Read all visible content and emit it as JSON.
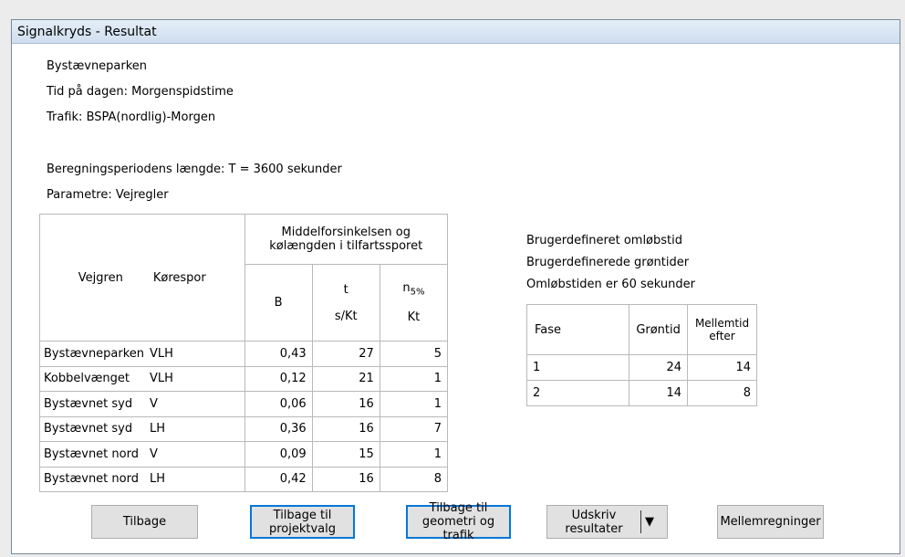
{
  "window": {
    "title": "Signalkryds - Resultat"
  },
  "info": {
    "location": "Bystævneparken",
    "time_of_day": "Tid på dagen: Morgenspidstime",
    "traffic": "Trafik: BSPA(nordlig)-Morgen",
    "period": "Beregningsperiodens længde: T = 3600 sekunder",
    "parameters": "Parametre: Vejregler"
  },
  "results": {
    "header": {
      "road": "Vejgren",
      "lane": "Kørespor",
      "group": "Middelforsinkelsen og kølængden i tilfartssporet",
      "col_b": "B",
      "col_t": "t",
      "col_t_unit": "s/Kt",
      "col_n": "n",
      "col_n_sub": "5%",
      "col_n_unit": "Kt"
    },
    "rows": [
      {
        "road": "Bystævneparken",
        "lane": "VLH",
        "b": "0,43",
        "t": "27",
        "n": "5"
      },
      {
        "road": "Kobbelvænget",
        "lane": "VLH",
        "b": "0,12",
        "t": "21",
        "n": "1"
      },
      {
        "road": "Bystævnet syd",
        "lane": "V",
        "b": "0,06",
        "t": "16",
        "n": "1"
      },
      {
        "road": "Bystævnet syd",
        "lane": "LH",
        "b": "0,36",
        "t": "16",
        "n": "7"
      },
      {
        "road": "Bystævnet nord",
        "lane": "V",
        "b": "0,09",
        "t": "15",
        "n": "1"
      },
      {
        "road": "Bystævnet nord",
        "lane": "LH",
        "b": "0,42",
        "t": "16",
        "n": "8"
      }
    ]
  },
  "cycle": {
    "line1": "Brugerdefineret omløbstid",
    "line2": "Brugerdefinerede grøntider",
    "line3": "Omløbstiden er 60 sekunder"
  },
  "phases": {
    "header": {
      "fase": "Fase",
      "green": "Grøntid",
      "inter": "Mellemtid efter"
    },
    "rows": [
      {
        "fase": "1",
        "green": "24",
        "inter": "14"
      },
      {
        "fase": "2",
        "green": "14",
        "inter": "8"
      }
    ]
  },
  "buttons": {
    "back": "Tilbage",
    "back_project": "Tilbage til projektvalg",
    "back_geometry": "Tilbage til geometri og trafik",
    "print": "Udskriv resultater",
    "intermediate": "Mellemregninger"
  }
}
